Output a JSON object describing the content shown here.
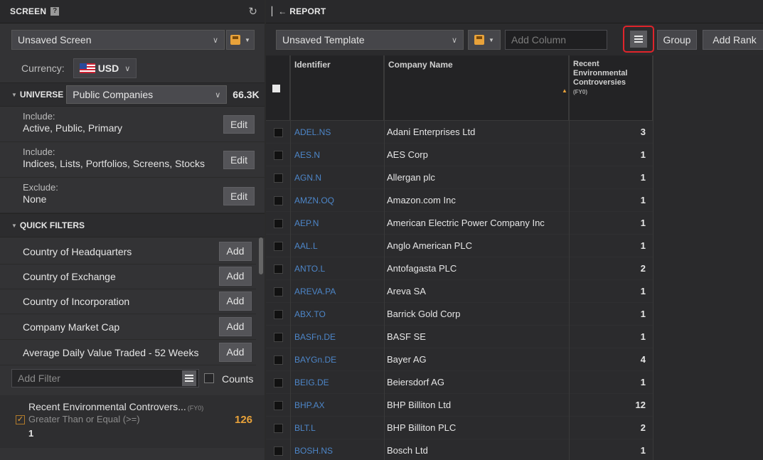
{
  "screen": {
    "title": "SCREEN",
    "help": "?",
    "refresh_icon": "refresh-icon",
    "screen_name": "Unsaved Screen",
    "currency_label": "Currency:",
    "currency": "USD",
    "universe": {
      "label": "UNIVERSE",
      "selected": "Public Companies",
      "count": "66.3K"
    },
    "include_rows": [
      {
        "label": "Include:",
        "value": "Active, Public, Primary",
        "button": "Edit"
      },
      {
        "label": "Include:",
        "value": "Indices, Lists, Portfolios, Screens, Stocks",
        "button": "Edit"
      },
      {
        "label": "Exclude:",
        "value": "None",
        "button": "Edit"
      }
    ],
    "quick_filters_label": "QUICK FILTERS",
    "quick_filters": [
      {
        "label": "Country of Headquarters",
        "button": "Add"
      },
      {
        "label": "Country of Exchange",
        "button": "Add"
      },
      {
        "label": "Country of Incorporation",
        "button": "Add"
      },
      {
        "label": "Company Market Cap",
        "button": "Add"
      },
      {
        "label": "Average Daily Value Traded - 52 Weeks",
        "button": "Add"
      }
    ],
    "add_filter_placeholder": "Add Filter",
    "counts_label": "Counts",
    "active_filter": {
      "title": "Recent Environmental Controvers...",
      "period": "(FY0)",
      "operator": "Greater Than or Equal (>=)",
      "value": "1",
      "count": "126"
    }
  },
  "report": {
    "title": "REPORT",
    "template_name": "Unsaved Template",
    "add_column_placeholder": "Add Column",
    "group_label": "Group",
    "rank_label": "Add Rank",
    "columns": {
      "identifier": "Identifier",
      "company": "Company Name",
      "recent_line1": "Recent",
      "recent_line2": "Environmental",
      "recent_line3": "Controversies",
      "recent_period": "(FY0)"
    },
    "rows": [
      {
        "id": "ADEL.NS",
        "name": "Adani Enterprises Ltd",
        "value": "3"
      },
      {
        "id": "AES.N",
        "name": "AES Corp",
        "value": "1"
      },
      {
        "id": "AGN.N",
        "name": "Allergan plc",
        "value": "1"
      },
      {
        "id": "AMZN.OQ",
        "name": "Amazon.com Inc",
        "value": "1"
      },
      {
        "id": "AEP.N",
        "name": "American Electric Power Company Inc",
        "value": "1"
      },
      {
        "id": "AAL.L",
        "name": "Anglo American PLC",
        "value": "1"
      },
      {
        "id": "ANTO.L",
        "name": "Antofagasta PLC",
        "value": "2"
      },
      {
        "id": "AREVA.PA",
        "name": "Areva SA",
        "value": "1"
      },
      {
        "id": "ABX.TO",
        "name": "Barrick Gold Corp",
        "value": "1"
      },
      {
        "id": "BASFn.DE",
        "name": "BASF SE",
        "value": "1"
      },
      {
        "id": "BAYGn.DE",
        "name": "Bayer AG",
        "value": "4"
      },
      {
        "id": "BEIG.DE",
        "name": "Beiersdorf AG",
        "value": "1"
      },
      {
        "id": "BHP.AX",
        "name": "BHP Billiton Ltd",
        "value": "12"
      },
      {
        "id": "BLT.L",
        "name": "BHP Billiton PLC",
        "value": "2"
      },
      {
        "id": "BOSH.NS",
        "name": "Bosch Ltd",
        "value": "1"
      }
    ]
  },
  "colors": {
    "accent": "#e8a23a",
    "link": "#4d86c8",
    "highlight": "#e0242b"
  }
}
